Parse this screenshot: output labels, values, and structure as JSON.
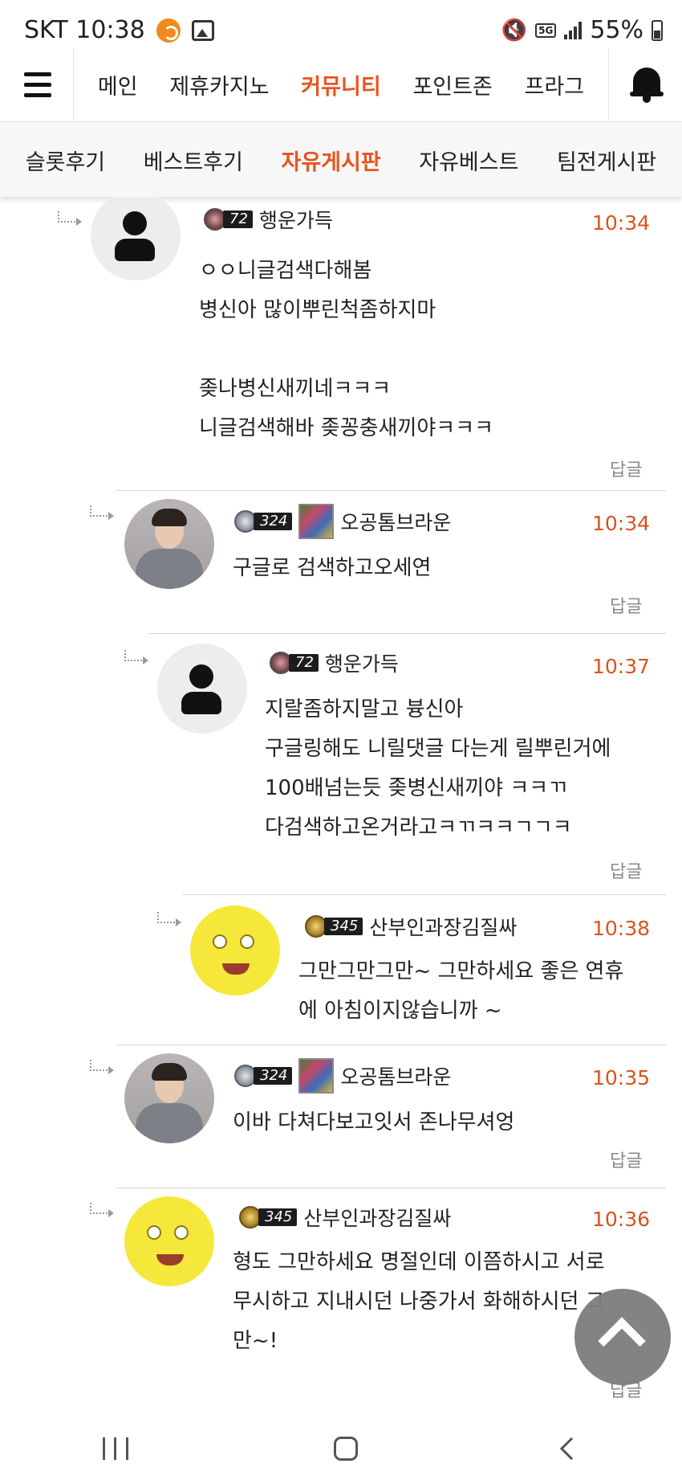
{
  "status_bar": {
    "carrier_time": "SKT 10:38",
    "network": "5G",
    "battery": "55%"
  },
  "top_nav": {
    "items": [
      "메인",
      "제휴카지노",
      "커뮤니티",
      "포인트존",
      "프라그"
    ],
    "active_index": 2
  },
  "sub_nav": {
    "items": [
      "슬롯후기",
      "베스트후기",
      "자유게시판",
      "자유베스트",
      "팀전게시판"
    ],
    "active_index": 2
  },
  "comments": [
    {
      "level": "72",
      "nickname": "행운가득",
      "time": "10:34",
      "text": "ㅇㅇ니글검색다해봄\n병신아 많이뿌린척좀하지마\n\n좆나병신새끼네ㅋㅋㅋ\n니글검색해바 좆꽁충새끼야ㅋㅋㅋ",
      "reply": "답글"
    },
    {
      "level": "324",
      "nickname": "오공톰브라운",
      "time": "10:34",
      "text": "구글로 검색하고오세연",
      "reply": "답글"
    },
    {
      "level": "72",
      "nickname": "행운가득",
      "time": "10:37",
      "text": "지랄좀하지말고 븅신아\n구글링해도 니릴댓글 다는게 릴뿌린거에\n100배넘는듯 좆병신새끼야 ㅋㅋㄲ\n다검색하고온거라고ㅋㄲㅋㅋㄱㄱㅋ",
      "reply": "답글"
    },
    {
      "level": "345",
      "nickname": "산부인과장김질싸",
      "time": "10:38",
      "text": "그만그만그만~ 그만하세요 좋은 연휴\n에 아침이지않습니까 ~",
      "reply": ""
    },
    {
      "level": "324",
      "nickname": "오공톰브라운",
      "time": "10:35",
      "text": "이바 다쳐다보고잇서 존나무셔엉",
      "reply": "답글"
    },
    {
      "level": "345",
      "nickname": "산부인과장김질싸",
      "time": "10:36",
      "text": "형도 그만하세요 명절인데 이쯤하시고 서로\n무시하고 지내시던 나중가서 화해하시던 그\n만~!",
      "reply": "답글"
    }
  ],
  "colors": {
    "accent": "#e8541e",
    "time": "#d9541e"
  }
}
